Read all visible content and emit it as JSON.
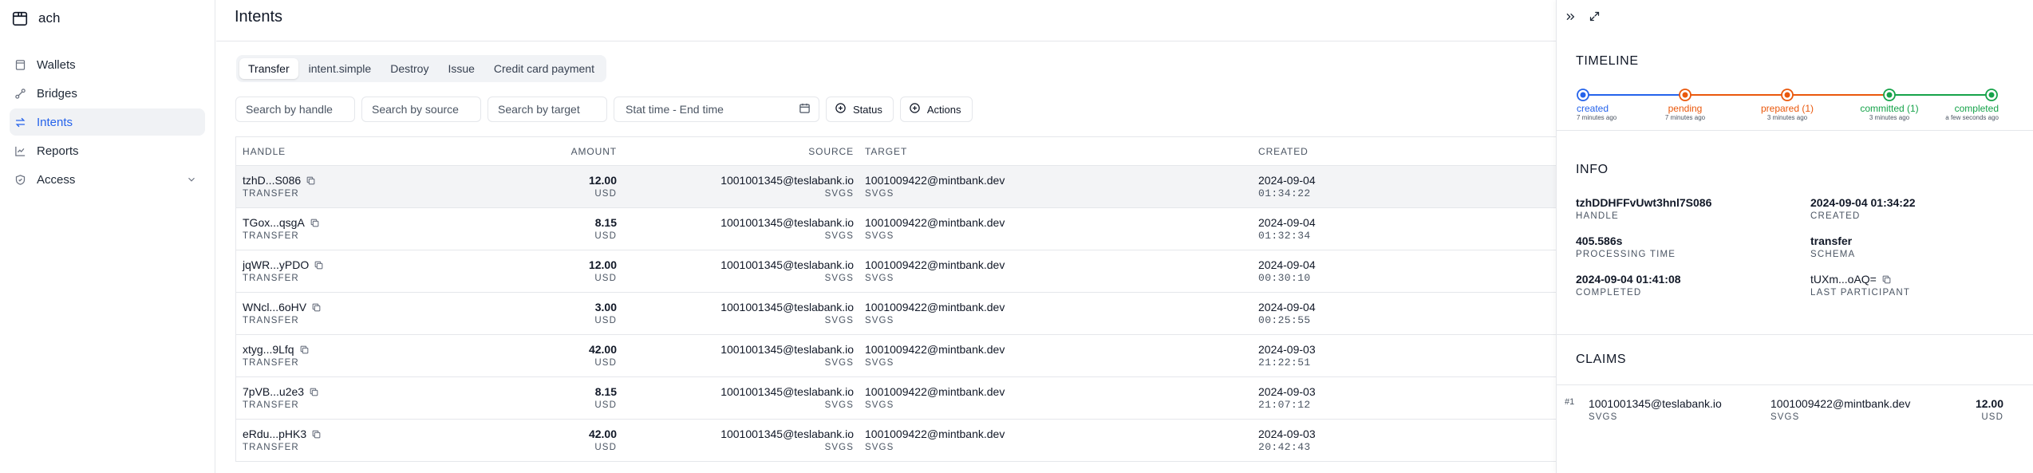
{
  "app": {
    "name": "ach"
  },
  "sidebar": {
    "items": [
      {
        "label": "Wallets"
      },
      {
        "label": "Bridges"
      },
      {
        "label": "Intents"
      },
      {
        "label": "Reports"
      },
      {
        "label": "Access"
      }
    ]
  },
  "main": {
    "title": "Intents",
    "tabs": [
      {
        "label": "Transfer"
      },
      {
        "label": "intent.simple"
      },
      {
        "label": "Destroy"
      },
      {
        "label": "Issue"
      },
      {
        "label": "Credit card payment"
      }
    ],
    "filters": {
      "handle_placeholder": "Search by handle",
      "source_placeholder": "Search by source",
      "target_placeholder": "Search by target",
      "date_placeholder": "Stat time - End time",
      "status_label": "Status",
      "actions_label": "Actions"
    },
    "columns": {
      "handle": "HANDLE",
      "amount": "AMOUNT",
      "source": "SOURCE",
      "target": "TARGET",
      "created": "CREATED"
    },
    "rows": [
      {
        "handle": "tzhD...S086",
        "type": "TRANSFER",
        "amount": "12.00",
        "currency": "USD",
        "source": "1001001345@teslabank.io",
        "source_sub": "SVGS",
        "target": "1001009422@mintbank.dev",
        "target_sub": "SVGS",
        "date": "2024-09-04",
        "time": "01:34:22"
      },
      {
        "handle": "TGox...qsgA",
        "type": "TRANSFER",
        "amount": "8.15",
        "currency": "USD",
        "source": "1001001345@teslabank.io",
        "source_sub": "SVGS",
        "target": "1001009422@mintbank.dev",
        "target_sub": "SVGS",
        "date": "2024-09-04",
        "time": "01:32:34"
      },
      {
        "handle": "jqWR...yPDO",
        "type": "TRANSFER",
        "amount": "12.00",
        "currency": "USD",
        "source": "1001001345@teslabank.io",
        "source_sub": "SVGS",
        "target": "1001009422@mintbank.dev",
        "target_sub": "SVGS",
        "date": "2024-09-04",
        "time": "00:30:10"
      },
      {
        "handle": "WNcl...6oHV",
        "type": "TRANSFER",
        "amount": "3.00",
        "currency": "USD",
        "source": "1001001345@teslabank.io",
        "source_sub": "SVGS",
        "target": "1001009422@mintbank.dev",
        "target_sub": "SVGS",
        "date": "2024-09-04",
        "time": "00:25:55"
      },
      {
        "handle": "xtyg...9Lfq",
        "type": "TRANSFER",
        "amount": "42.00",
        "currency": "USD",
        "source": "1001001345@teslabank.io",
        "source_sub": "SVGS",
        "target": "1001009422@mintbank.dev",
        "target_sub": "SVGS",
        "date": "2024-09-03",
        "time": "21:22:51"
      },
      {
        "handle": "7pVB...u2e3",
        "type": "TRANSFER",
        "amount": "8.15",
        "currency": "USD",
        "source": "1001001345@teslabank.io",
        "source_sub": "SVGS",
        "target": "1001009422@mintbank.dev",
        "target_sub": "SVGS",
        "date": "2024-09-03",
        "time": "21:07:12"
      },
      {
        "handle": "eRdu...pHK3",
        "type": "TRANSFER",
        "amount": "42.00",
        "currency": "USD",
        "source": "1001001345@teslabank.io",
        "source_sub": "SVGS",
        "target": "1001009422@mintbank.dev",
        "target_sub": "SVGS",
        "date": "2024-09-03",
        "time": "20:42:43"
      }
    ]
  },
  "panel": {
    "timeline": {
      "title": "TIMELINE",
      "steps": [
        {
          "label": "created",
          "time": "7 minutes ago",
          "color": "#2563eb"
        },
        {
          "label": "pending",
          "time": "7 minutes ago",
          "color": "#ea580c"
        },
        {
          "label": "prepared (1)",
          "time": "3 minutes ago",
          "color": "#ea580c"
        },
        {
          "label": "committed (1)",
          "time": "3 minutes ago",
          "color": "#16a34a"
        },
        {
          "label": "completed",
          "time": "a few seconds ago",
          "color": "#16a34a"
        }
      ]
    },
    "info": {
      "title": "INFO",
      "handle_value": "tzhDDHFFvUwt3hnl7S086",
      "handle_label": "HANDLE",
      "created_value": "2024-09-04 01:34:22",
      "created_label": "CREATED",
      "processing_value": "405.586s",
      "processing_label": "PROCESSING TIME",
      "schema_value": "transfer",
      "schema_label": "SCHEMA",
      "completed_value": "2024-09-04 01:41:08",
      "completed_label": "COMPLETED",
      "participant_value": "tUXm...oAQ=",
      "participant_label": "LAST PARTICIPANT"
    },
    "claims": {
      "title": "CLAIMS",
      "items": [
        {
          "num": "#1",
          "source": "1001001345@teslabank.io",
          "source_sub": "SVGS",
          "target": "1001009422@mintbank.dev",
          "target_sub": "SVGS",
          "amount": "12.00",
          "currency": "USD"
        }
      ]
    }
  }
}
